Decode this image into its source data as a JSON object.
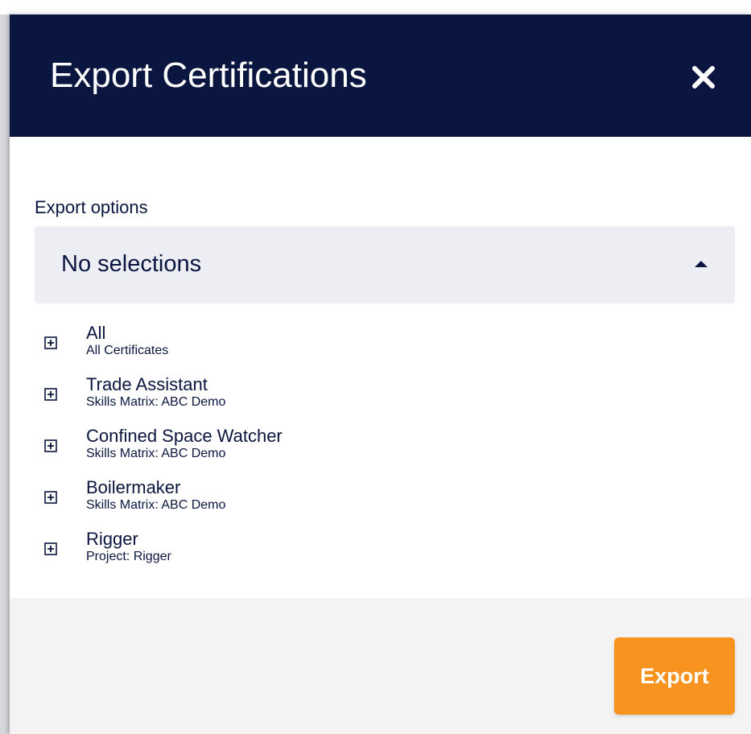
{
  "modal": {
    "title": "Export Certifications",
    "close_icon": "close-icon",
    "header_color": "#0b1640",
    "accent_color": "#f7931e"
  },
  "export_options": {
    "label": "Export options",
    "selected_value": "No selections",
    "dropdown_icon": "caret-up-icon",
    "items": [
      {
        "title": "All",
        "subtitle": "All Certificates",
        "icon": "plus-square-icon"
      },
      {
        "title": "Trade Assistant",
        "subtitle": "Skills Matrix: ABC Demo",
        "icon": "plus-square-icon"
      },
      {
        "title": "Confined Space Watcher",
        "subtitle": "Skills Matrix: ABC Demo",
        "icon": "plus-square-icon"
      },
      {
        "title": "Boilermaker",
        "subtitle": "Skills Matrix: ABC Demo",
        "icon": "plus-square-icon"
      },
      {
        "title": "Rigger",
        "subtitle": "Project: Rigger",
        "icon": "plus-square-icon"
      }
    ]
  },
  "footer": {
    "export_label": "Export"
  }
}
